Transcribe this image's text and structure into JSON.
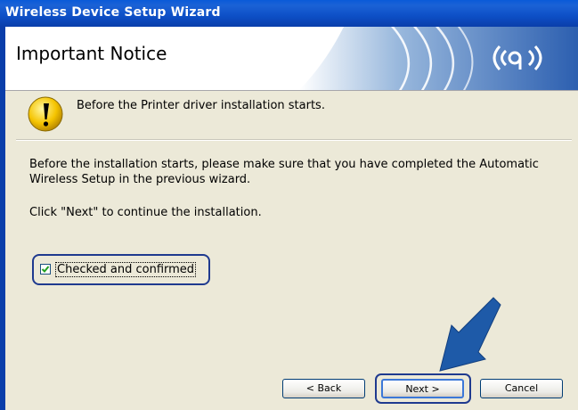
{
  "window": {
    "title": "Wireless Device Setup Wizard"
  },
  "header": {
    "title": "Important Notice",
    "logo_icon": "wireless-signal-icon"
  },
  "notice": {
    "icon": "warning-exclamation-icon",
    "text": "Before the Printer driver installation starts."
  },
  "body": {
    "paragraph1": "Before the installation starts, please make sure that you have completed the Automatic Wireless Setup in the previous wizard.",
    "paragraph2": "Click \"Next\" to continue the installation."
  },
  "checkbox": {
    "label": "Checked and confirmed",
    "checked": true
  },
  "buttons": {
    "back": "< Back",
    "next": "Next >",
    "cancel": "Cancel"
  },
  "colors": {
    "titlebar": "#0a5ad8",
    "highlight": "#1f3a8f",
    "arrow": "#1e5aa8"
  }
}
